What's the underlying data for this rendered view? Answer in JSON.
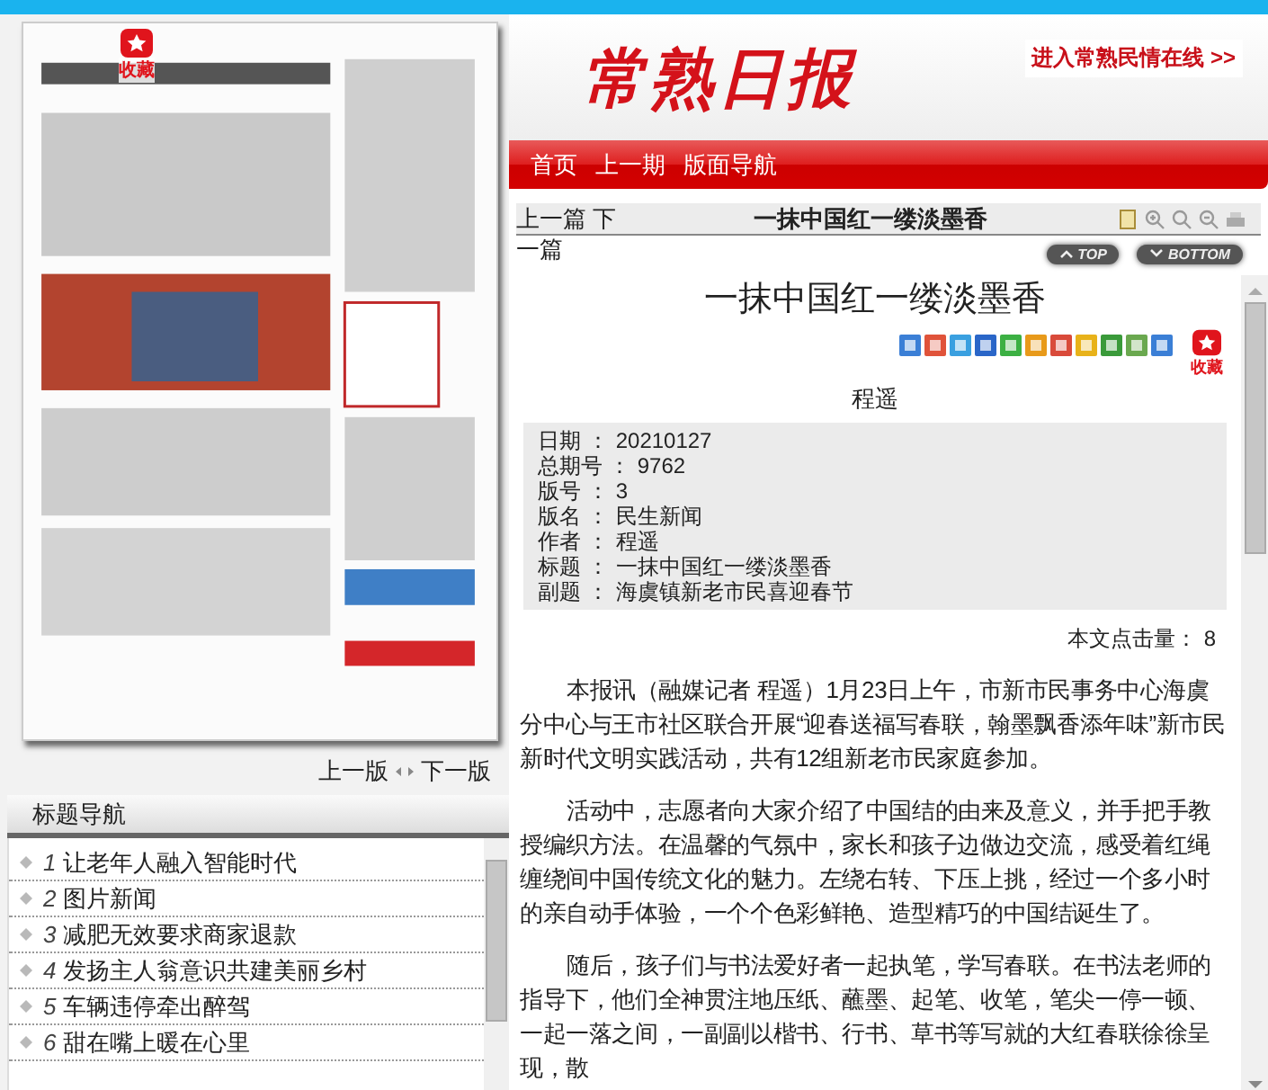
{
  "header": {
    "logo": "常熟日报",
    "link": "进入常熟民情在线 >>"
  },
  "nav": [
    "首页",
    "上一期",
    "版面导航"
  ],
  "page_image": {
    "kind": "picture",
    "badge": "收藏"
  },
  "edition_nav": {
    "prev": "上一版",
    "next": "下一版"
  },
  "title_nav": {
    "heading": "标题导航",
    "items": [
      {
        "number": "1",
        "title": "让老年人融入智能时代"
      },
      {
        "number": "2",
        "title": "图片新闻"
      },
      {
        "number": "3",
        "title": "减肥无效要求商家退款"
      },
      {
        "number": "4",
        "title": "发扬主人翁意识共建美丽乡村"
      },
      {
        "number": "5",
        "title": "车辆违停牵出醉驾"
      },
      {
        "number": "6",
        "title": "甜在嘴上暖在心里"
      }
    ]
  },
  "toolbar": {
    "prev": "上一篇",
    "next": "下一篇",
    "title": "一抹中国红一缕淡墨香",
    "top": "TOP",
    "bottom": "BOTTOM"
  },
  "article": {
    "title": "一抹中国红一缕淡墨香",
    "favorite": "收藏",
    "author": "程遥",
    "meta": [
      {
        "label": "日期 ：",
        "value": "20210127"
      },
      {
        "label": "总期号 ：",
        "value": "9762"
      },
      {
        "label": "版号 ：",
        "value": "3"
      },
      {
        "label": "版名 ：",
        "value": "民生新闻"
      },
      {
        "label": "作者 ：",
        "value": "程遥"
      },
      {
        "label": "标题 ：",
        "value": "一抹中国红一缕淡墨香"
      },
      {
        "label": "副题 ：",
        "value": "海虞镇新老市民喜迎春节"
      }
    ],
    "hits_label": "本文点击量：",
    "hits": "8",
    "paragraphs": [
      "本报讯（融媒记者 程遥）1月23日上午，市新市民事务中心海虞分中心与王市社区联合开展“迎春送福写春联，翰墨飘香添年味”新市民新时代文明实践活动，共有12组新老市民家庭参加。",
      "活动中，志愿者向大家介绍了中国结的由来及意义，并手把手教授编织方法。在温馨的气氛中，家长和孩子边做边交流，感受着红绳缠绕间中国传统文化的魅力。左绕右转、下压上挑，经过一个多小时的亲自动手体验，一个个色彩鲜艳、造型精巧的中国结诞生了。",
      "随后，孩子们与书法爱好者一起执笔，学写春联。在书法老师的指导下，他们全神贯注地压纸、蘸墨、起笔、收笔，笔尖一停一顿、一起一落之间，一副副以楷书、行书、草书等写就的大红春联徐徐呈现，散"
    ]
  }
}
